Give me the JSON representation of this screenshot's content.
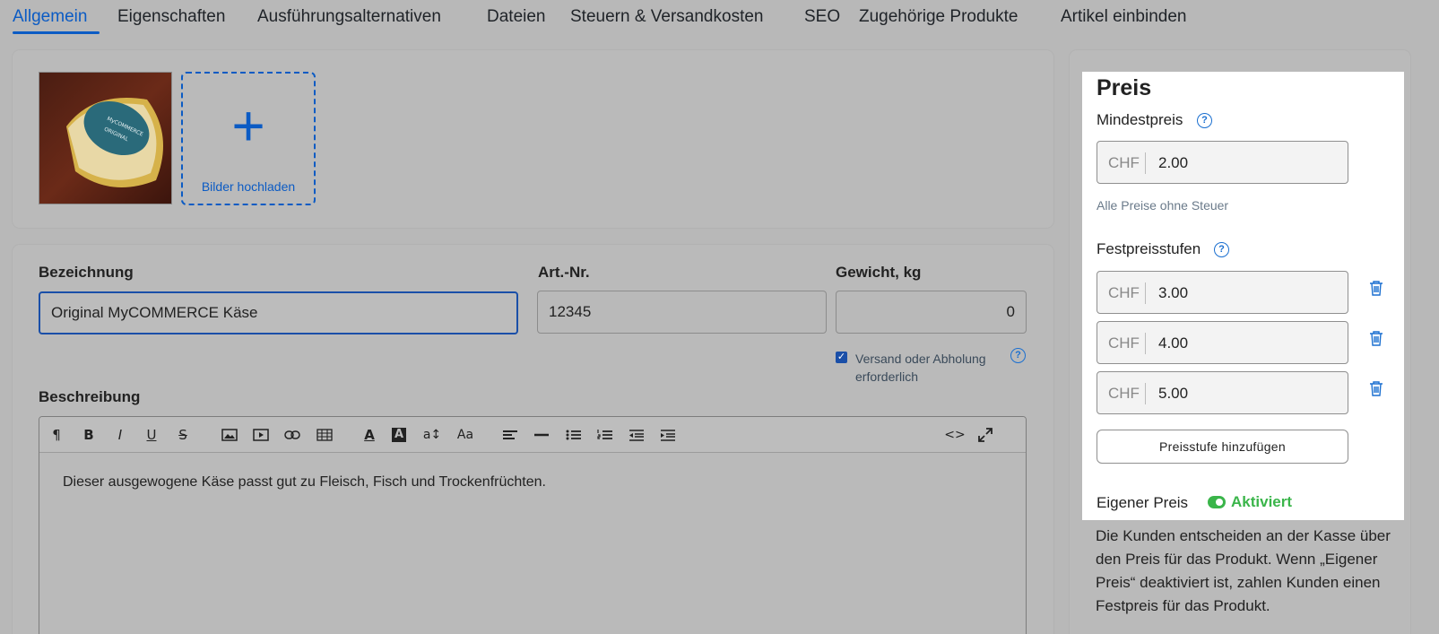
{
  "tabs": [
    {
      "label": "Allgemein",
      "active": true
    },
    {
      "label": "Eigenschaften"
    },
    {
      "label": "Ausführungsalternativen"
    },
    {
      "label": "Dateien"
    },
    {
      "label": "Steuern & Versandkosten"
    },
    {
      "label": "SEO"
    },
    {
      "label": "Zugehörige Produkte"
    },
    {
      "label": "Artikel einbinden"
    }
  ],
  "images": {
    "upload_label": "Bilder hochladen",
    "thumb_text": "MyCOMMERCE ORIGINAL"
  },
  "form": {
    "name_label": "Bezeichnung",
    "name_value": "Original MyCOMMERCE Käse",
    "sku_label": "Art.-Nr.",
    "sku_value": "12345",
    "weight_label": "Gewicht, kg",
    "weight_value": "0",
    "shipping_checkbox_label": "Versand oder Abholung erforderlich",
    "shipping_checked": true,
    "description_label": "Beschreibung",
    "description_text": "Dieser ausgewogene Käse passt gut zu Fleisch, Fisch und Trockenfrüchten."
  },
  "editor_toolbar": {
    "paragraph": "¶",
    "bold": "B",
    "italic": "I",
    "underline": "U",
    "strike": "S",
    "font_color": "A",
    "bg_color": "A",
    "font_size": "a↕",
    "font_case": "Aa",
    "code": "<>"
  },
  "price": {
    "title": "Preis",
    "min_label": "Mindestpreis",
    "currency": "CHF",
    "min_value": "2.00",
    "note": "Alle Preise ohne Steuer",
    "tiers_label": "Festpreisstufen",
    "tiers": [
      "3.00",
      "4.00",
      "5.00"
    ],
    "add_button": "Preisstufe hinzufügen",
    "own_price_label": "Eigener Preis",
    "own_price_status": "Aktiviert",
    "own_price_enabled": true,
    "own_price_description": "Die Kunden entscheiden an der Kasse über den Preis für das Produkt. Wenn „Eigener Preis“ deaktiviert ist, zahlen Kunden einen Festpreis für das Produkt."
  },
  "colors": {
    "accent": "#0b5bc4",
    "active_green": "#3ab54a",
    "overlay_gray": "#b8b8b8"
  }
}
